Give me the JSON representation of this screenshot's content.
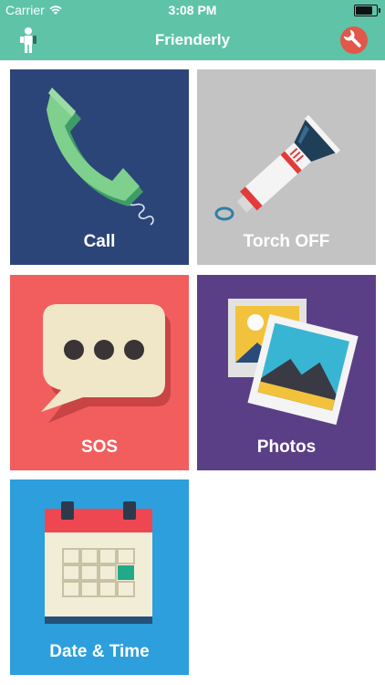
{
  "status_bar": {
    "carrier": "Carrier",
    "time": "3:08 PM",
    "icons": [
      "wifi-icon",
      "battery-icon"
    ]
  },
  "nav": {
    "title": "Frienderly",
    "left_icon": "user-profile-icon",
    "right_icon": "wrench-settings-icon"
  },
  "tiles": [
    {
      "label": "Call",
      "icon": "phone-icon",
      "color": "#2c4578"
    },
    {
      "label": "Torch OFF",
      "icon": "flashlight-icon",
      "color": "#c3c3c3"
    },
    {
      "label": "SOS",
      "icon": "chat-bubble-icon",
      "color": "#f25e5e"
    },
    {
      "label": "Photos",
      "icon": "photos-icon",
      "color": "#5b3f86"
    },
    {
      "label": "Date & Time",
      "icon": "calendar-icon",
      "color": "#2c9fdc"
    }
  ],
  "colors": {
    "accent": "#5fc4a7",
    "settings_button": "#e0584a"
  }
}
